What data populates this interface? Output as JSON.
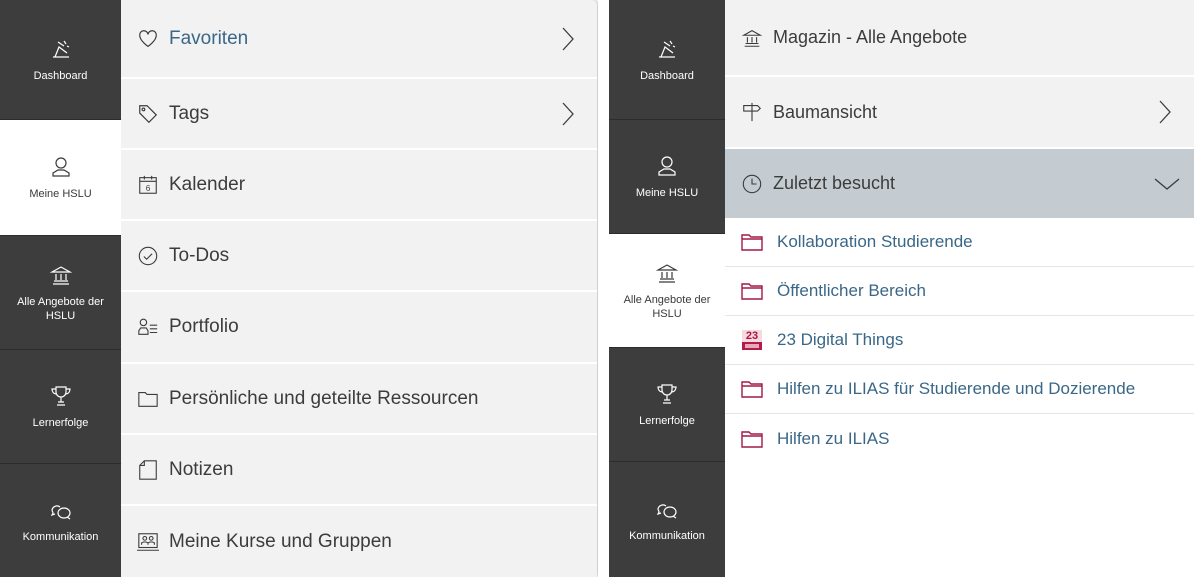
{
  "left_panel": {
    "rail": [
      {
        "label": "Dashboard",
        "icon": "dashboard-icon",
        "active": false
      },
      {
        "label": "Meine HSLU",
        "icon": "person-icon",
        "active": true
      },
      {
        "label": "Alle Angebote der HSLU",
        "icon": "institution-icon",
        "active": false
      },
      {
        "label": "Lernerfolge",
        "icon": "trophy-icon",
        "active": false
      },
      {
        "label": "Kommunikation",
        "icon": "chat-icon",
        "active": false
      }
    ],
    "menu": [
      {
        "label": "Favoriten",
        "icon": "heart-icon",
        "has_arrow": true
      },
      {
        "label": "Tags",
        "icon": "tag-icon",
        "has_arrow": true
      },
      {
        "label": "Kalender",
        "icon": "calendar-icon",
        "icon_text": "6",
        "has_arrow": false
      },
      {
        "label": "To-Dos",
        "icon": "check-circle-icon",
        "has_arrow": false
      },
      {
        "label": "Portfolio",
        "icon": "portfolio-icon",
        "has_arrow": false
      },
      {
        "label": "Persönliche und geteilte Ressourcen",
        "icon": "folder-icon",
        "has_arrow": false
      },
      {
        "label": "Notizen",
        "icon": "note-icon",
        "has_arrow": false
      },
      {
        "label": "Meine Kurse und Gruppen",
        "icon": "courses-icon",
        "has_arrow": false
      }
    ]
  },
  "right_panel": {
    "rail": [
      {
        "label": "Dashboard",
        "icon": "dashboard-icon",
        "active": false
      },
      {
        "label": "Meine HSLU",
        "icon": "person-icon",
        "active": false
      },
      {
        "label": "Alle Angebote der HSLU",
        "icon": "institution-icon",
        "active": true
      },
      {
        "label": "Lernerfolge",
        "icon": "trophy-icon",
        "active": false
      },
      {
        "label": "Kommunikation",
        "icon": "chat-icon",
        "active": false
      }
    ],
    "menu": [
      {
        "label": "Magazin - Alle Angebote",
        "icon": "institution-icon",
        "arrow": "none"
      },
      {
        "label": "Baumansicht",
        "icon": "signpost-icon",
        "arrow": "right"
      },
      {
        "label": "Zuletzt besucht",
        "icon": "clock-icon",
        "arrow": "down"
      }
    ],
    "recent": [
      {
        "label": "Kollaboration Studierende",
        "icon": "folder-icon"
      },
      {
        "label": "Öffentlicher Bereich",
        "icon": "folder-icon"
      },
      {
        "label": "23 Digital Things",
        "icon": "badge-23-icon",
        "badge_text": "23"
      },
      {
        "label": "Hilfen zu ILIAS für Studierende und Dozierende",
        "icon": "folder-icon"
      },
      {
        "label": "Hilfen zu ILIAS",
        "icon": "folder-icon"
      }
    ]
  },
  "colors": {
    "rail_bg": "#3d3d3d",
    "menu_bg": "#f2f2f2",
    "link_blue": "#3a6787",
    "folder_accent": "#a3184a",
    "expanded_bg": "#c4ccd1"
  }
}
